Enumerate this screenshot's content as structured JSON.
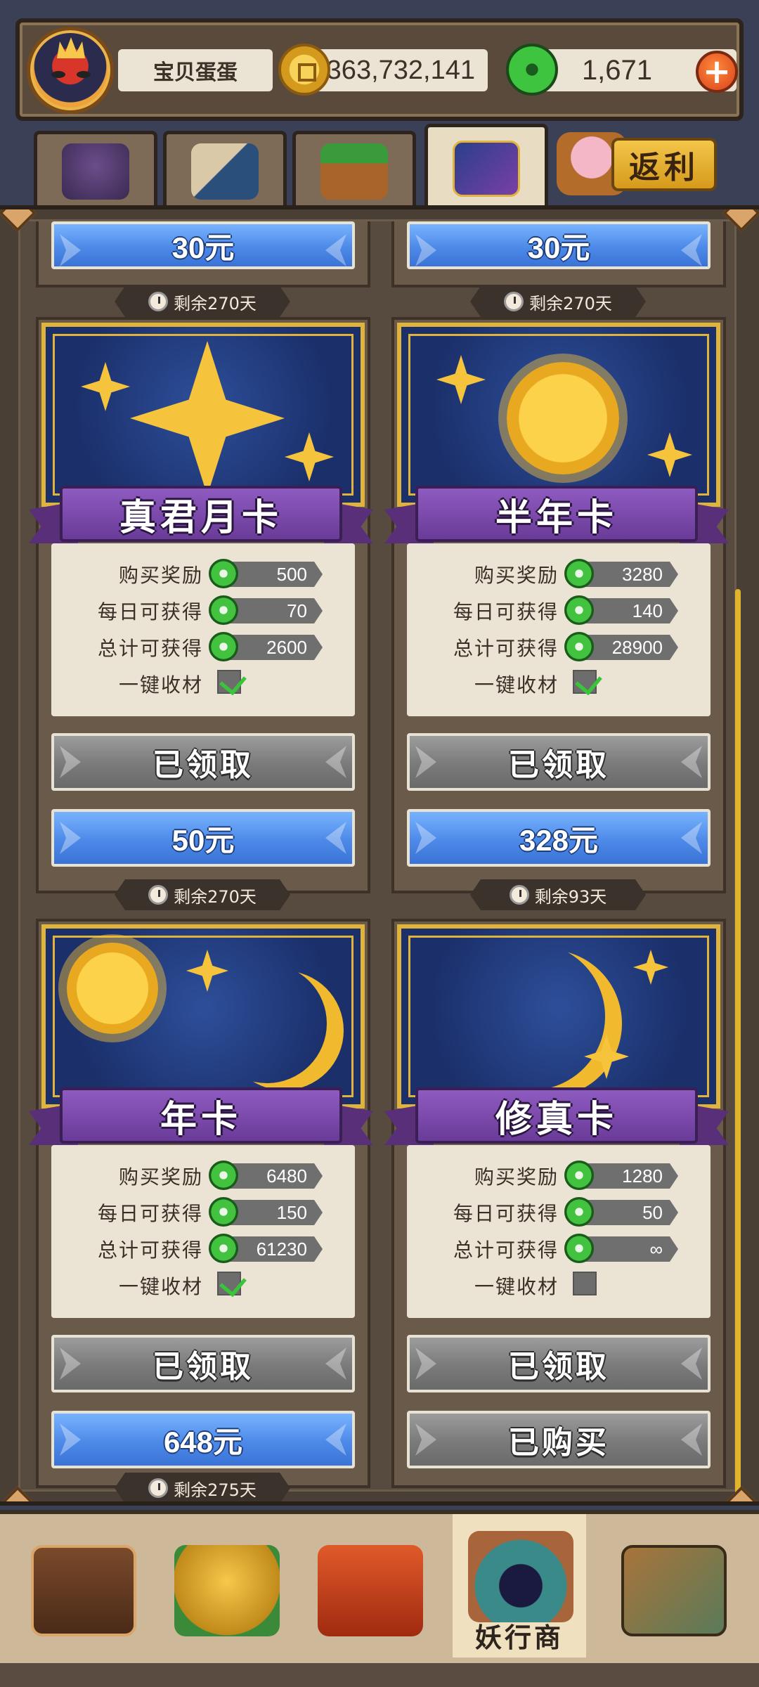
{
  "header": {
    "player_name": "宝贝蛋蛋",
    "coins": "363,732,141",
    "jade": "1,671",
    "plus_symbol": "+"
  },
  "tabs": [
    {
      "icon": "shadow-monster-icon"
    },
    {
      "icon": "feather-scroll-icon"
    },
    {
      "icon": "treasure-chest-icon"
    },
    {
      "icon": "moon-card-icon",
      "active": true
    }
  ],
  "rebate": {
    "label": "返利",
    "icon": "piggy-bank-icon"
  },
  "top_partial_cards": [
    {
      "price": "30元",
      "remaining": "剩余270天"
    },
    {
      "price": "30元",
      "remaining": "剩余270天"
    }
  ],
  "cards": [
    {
      "title": "真君月卡",
      "rows": [
        {
          "label": "购买奖励",
          "value": "500"
        },
        {
          "label": "每日可获得",
          "value": "70"
        },
        {
          "label": "总计可获得",
          "value": "2600"
        }
      ],
      "auto_collect_label": "一键收材",
      "auto_collect": true,
      "status": "已领取",
      "price": "50元",
      "remaining": "剩余270天"
    },
    {
      "title": "半年卡",
      "rows": [
        {
          "label": "购买奖励",
          "value": "3280"
        },
        {
          "label": "每日可获得",
          "value": "140"
        },
        {
          "label": "总计可获得",
          "value": "28900"
        }
      ],
      "auto_collect_label": "一键收材",
      "auto_collect": true,
      "status": "已领取",
      "price": "328元",
      "remaining": "剩余93天"
    },
    {
      "title": "年卡",
      "rows": [
        {
          "label": "购买奖励",
          "value": "6480"
        },
        {
          "label": "每日可获得",
          "value": "150"
        },
        {
          "label": "总计可获得",
          "value": "61230"
        }
      ],
      "auto_collect_label": "一键收材",
      "auto_collect": true,
      "status": "已领取",
      "price": "648元",
      "remaining": "剩余275天"
    },
    {
      "title": "修真卡",
      "rows": [
        {
          "label": "购买奖励",
          "value": "1280"
        },
        {
          "label": "每日可获得",
          "value": "50"
        },
        {
          "label": "总计可获得",
          "value": "∞"
        }
      ],
      "auto_collect_label": "一键收材",
      "auto_collect": false,
      "status": "已领取",
      "price": "已购买",
      "remaining": ""
    }
  ],
  "bottom_nav": [
    {
      "icon": "clock-chest-icon",
      "label": ""
    },
    {
      "icon": "gold-trophy-icon",
      "label": ""
    },
    {
      "icon": "demon-gate-icon",
      "label": ""
    },
    {
      "icon": "merchant-icon",
      "label": "妖行商",
      "active": true
    },
    {
      "icon": "star-book-icon",
      "label": ""
    }
  ],
  "colors": {
    "blue_button": "#4d8ae8",
    "gray_button": "#7a7a7a",
    "ribbon": "#6a3b98",
    "gold": "#e0b43a",
    "jade": "#43c240"
  }
}
